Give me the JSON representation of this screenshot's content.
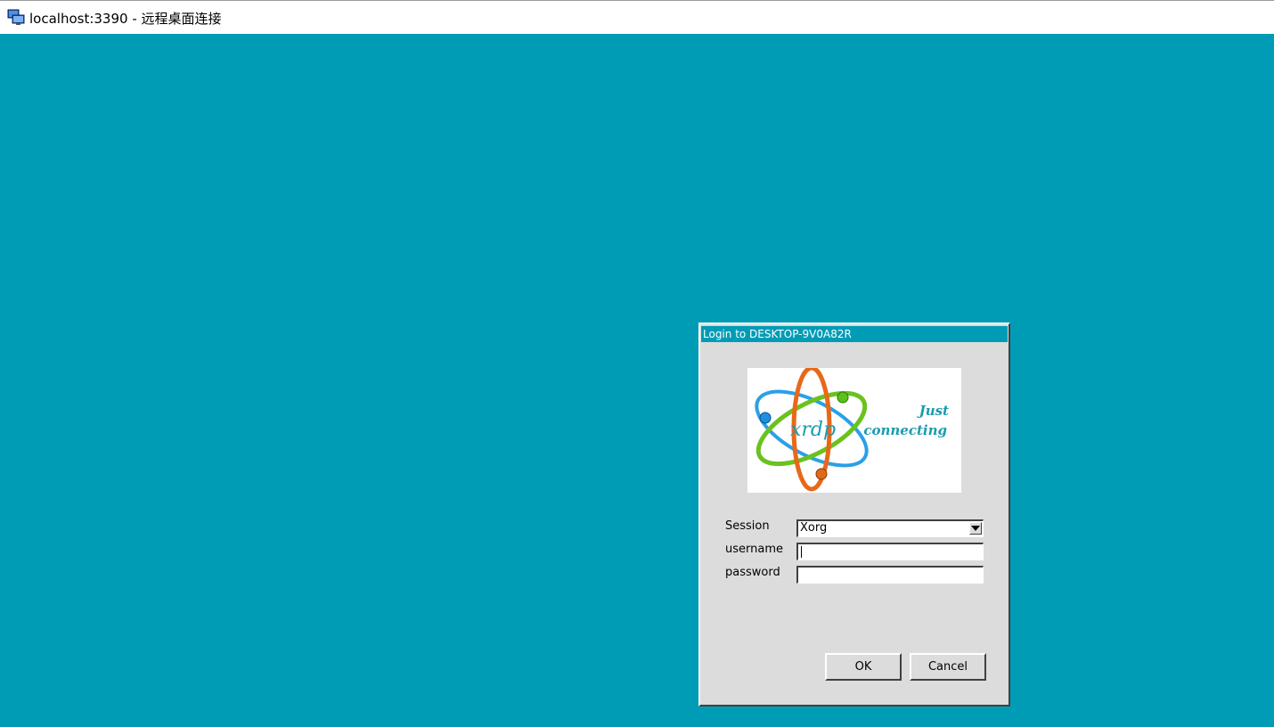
{
  "window": {
    "title": "localhost:3390 - 远程桌面连接",
    "icon": "remote-desktop-icon"
  },
  "login_dialog": {
    "title": "Login to DESKTOP-9V0A82R",
    "logo": {
      "text": "xrdp",
      "tagline_line1": "Just",
      "tagline_line2": "connecting"
    },
    "session_label": "Session",
    "session_value": "Xorg",
    "username_label": "username",
    "username_value": "",
    "password_label": "password",
    "password_value": "",
    "ok_label": "OK",
    "cancel_label": "Cancel"
  },
  "colors": {
    "desktop_background": "#009cb5",
    "dialog_background": "#dcdcdc",
    "title_bar": "#009cb5"
  }
}
